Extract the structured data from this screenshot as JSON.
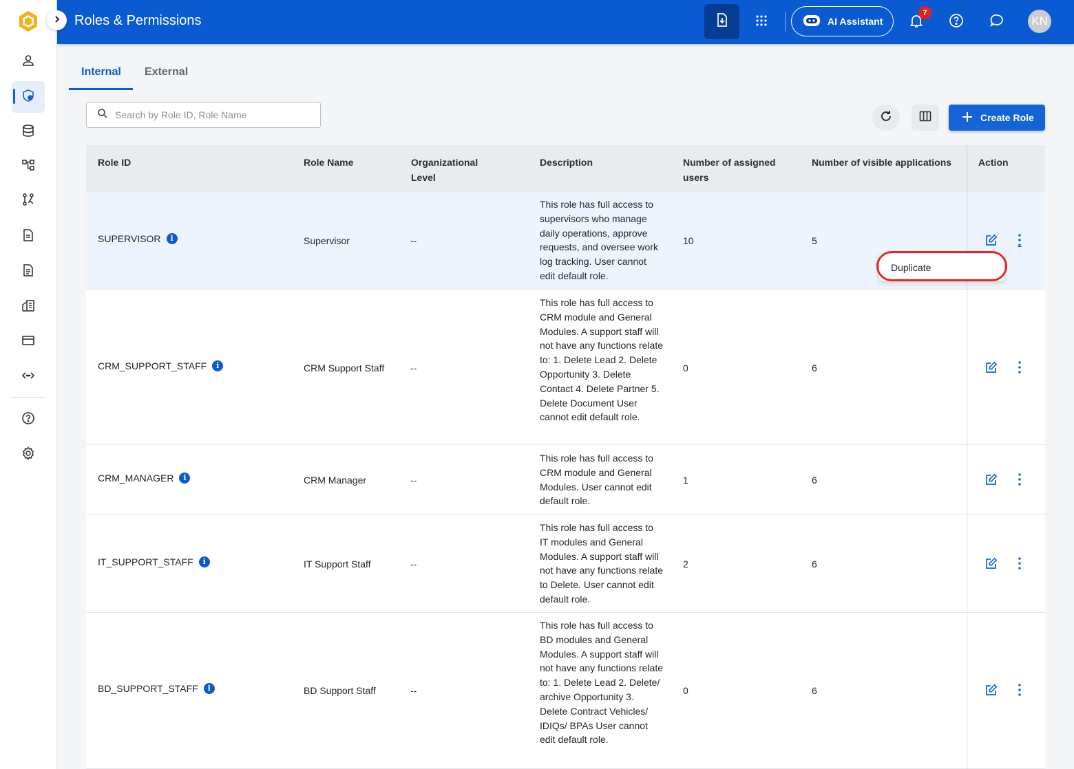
{
  "header": {
    "title": "Roles & Permissions",
    "ai_assistant_label": "AI Assistant",
    "notification_count": "7",
    "avatar_initials": "KN"
  },
  "tabs": [
    {
      "label": "Internal",
      "active": true
    },
    {
      "label": "External",
      "active": false
    }
  ],
  "search": {
    "placeholder": "Search by Role ID, Role Name",
    "value": ""
  },
  "toolbar": {
    "create_label": "Create Role"
  },
  "table": {
    "columns": [
      "Role ID",
      "Role Name",
      "Organizational Level",
      "Description",
      "Number of assigned users",
      "Number of visible applications",
      "Action"
    ],
    "rows": [
      {
        "role_id": "SUPERVISOR",
        "role_name": "Supervisor",
        "org_level": "--",
        "description": "This role has full access to supervisors who manage daily operations, approve requests, and oversee work log tracking. User cannot edit default role.",
        "assigned_users": "10",
        "visible_apps": "5"
      },
      {
        "role_id": "CRM_SUPPORT_STAFF",
        "role_name": "CRM Support Staff",
        "org_level": "--",
        "description": "This role has full access to CRM module and General Modules. A support staff will not have any functions relate to: 1. Delete Lead 2. Delete Opportunity 3. Delete Contact 4. Delete Partner 5. Delete Document User cannot edit default role.",
        "assigned_users": "0",
        "visible_apps": "6"
      },
      {
        "role_id": "CRM_MANAGER",
        "role_name": "CRM Manager",
        "org_level": "--",
        "description": "This role has full access to CRM module and General Modules. User cannot edit default role.",
        "assigned_users": "1",
        "visible_apps": "6"
      },
      {
        "role_id": "IT_SUPPORT_STAFF",
        "role_name": "IT Support Staff",
        "org_level": "--",
        "description": "This role has full access to IT modules and General Modules. A support staff will not have any functions relate to Delete. User cannot edit default role.",
        "assigned_users": "2",
        "visible_apps": "6"
      },
      {
        "role_id": "BD_SUPPORT_STAFF",
        "role_name": "BD Support Staff",
        "org_level": "--",
        "description": "This role has full access to BD modules and General Modules. A support staff will not have any functions relate to: 1. Delete Lead 2. Delete/ archive Opportunity 3. Delete Contract Vehicles/ IDIQs/ BPAs User cannot edit default role.",
        "assigned_users": "0",
        "visible_apps": "6"
      }
    ]
  },
  "row_menu": {
    "items": [
      "Duplicate"
    ]
  },
  "sidebar": {
    "items": [
      {
        "icon": "user-icon"
      },
      {
        "icon": "role-shield-icon",
        "active": true
      },
      {
        "icon": "database-icon"
      },
      {
        "icon": "hierarchy-icon"
      },
      {
        "icon": "workflow-icon"
      },
      {
        "icon": "document-icon"
      },
      {
        "icon": "report-icon"
      },
      {
        "icon": "building-icon"
      },
      {
        "icon": "card-icon"
      },
      {
        "icon": "api-icon"
      },
      {
        "icon": "help-icon"
      },
      {
        "icon": "settings-icon"
      }
    ]
  },
  "colors": {
    "primary": "#0a5bd1",
    "highlight_row": "#eef4fd",
    "annotation_ring": "#e8271b"
  }
}
